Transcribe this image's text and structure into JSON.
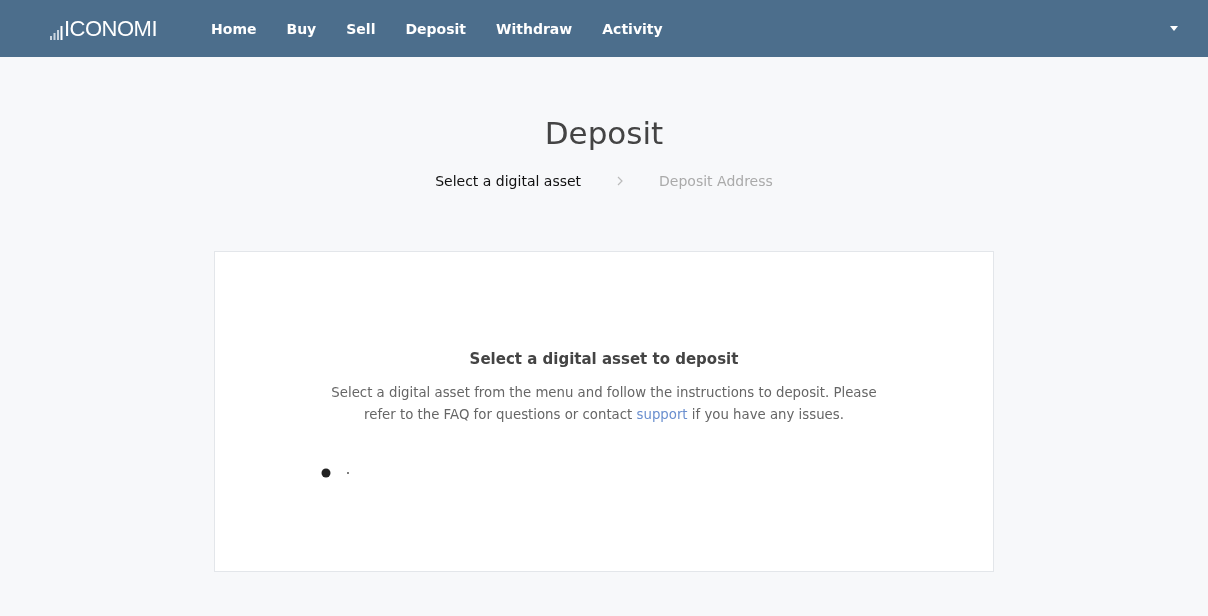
{
  "header": {
    "logo": "ICONOMI",
    "nav": [
      "Home",
      "Buy",
      "Sell",
      "Deposit",
      "Withdraw",
      "Activity"
    ]
  },
  "page": {
    "title": "Deposit"
  },
  "steps": [
    {
      "label": "Select a digital asset",
      "selected": true
    },
    {
      "label": "Deposit Address",
      "selected": false
    }
  ],
  "card": {
    "heading": "Select a digital asset to deposit",
    "text_before": "Select a digital asset from the menu and follow the instructions to deposit. Please refer to the FAQ for questions or contact",
    "link": "support",
    "text_after": "if you have any issues."
  }
}
